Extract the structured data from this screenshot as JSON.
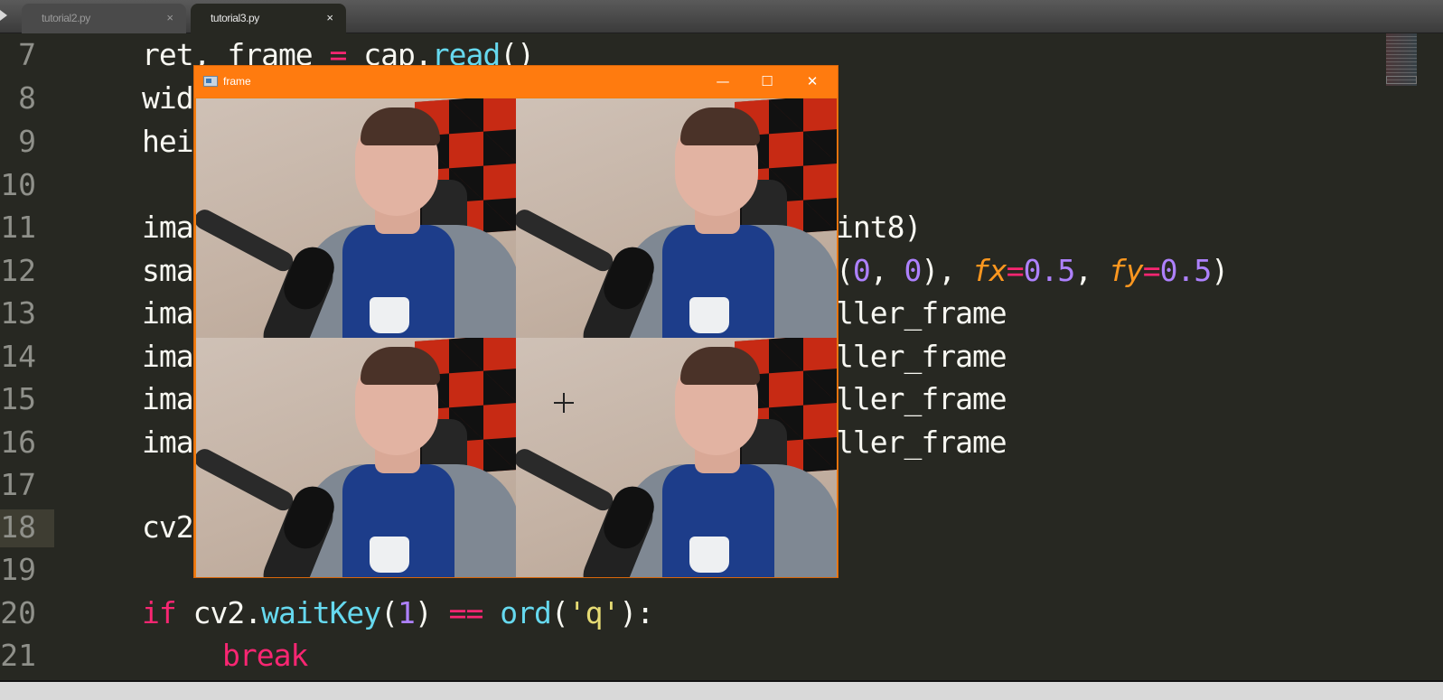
{
  "tabs": [
    {
      "label": "tutorial2.py",
      "close": "×",
      "active": false
    },
    {
      "label": "tutorial3.py",
      "close": "×",
      "active": true
    }
  ],
  "editor": {
    "current_line": "18",
    "lines": [
      {
        "no": "7",
        "left": "ret, frame = cap.read()",
        "right": ""
      },
      {
        "no": "8",
        "left": "wid",
        "right": ""
      },
      {
        "no": "9",
        "left": "hei",
        "right": ""
      },
      {
        "no": "10",
        "left": "",
        "right": ""
      },
      {
        "no": "11",
        "left": "ima",
        "right": "int8)"
      },
      {
        "no": "12",
        "left": "sma",
        "right": "(0, 0), fx=0.5, fy=0.5)"
      },
      {
        "no": "13",
        "left": "ima",
        "right": "ller_frame"
      },
      {
        "no": "14",
        "left": "ima",
        "right": "ller_frame"
      },
      {
        "no": "15",
        "left": "ima",
        "right": "ller_frame"
      },
      {
        "no": "16",
        "left": "ima",
        "right": "ller_frame"
      },
      {
        "no": "17",
        "left": "",
        "right": ""
      },
      {
        "no": "18",
        "left": "cv2",
        "right": ""
      },
      {
        "no": "19",
        "left": "",
        "right": ""
      },
      {
        "no": "20",
        "left": "if cv2.waitKey(1) == ord('q'):",
        "right": ""
      },
      {
        "no": "21",
        "left": "break",
        "right": ""
      }
    ]
  },
  "cv_window": {
    "title": "frame",
    "minimize": "—",
    "maximize": "☐",
    "close": "✕",
    "tiles": 4
  },
  "colors": {
    "editor_bg": "#272822",
    "keyword": "#f92672",
    "function": "#66d9ef",
    "number": "#ae81ff",
    "string": "#e6db74",
    "argument": "#fd971f",
    "window_titlebar": "#ff7b0f"
  }
}
